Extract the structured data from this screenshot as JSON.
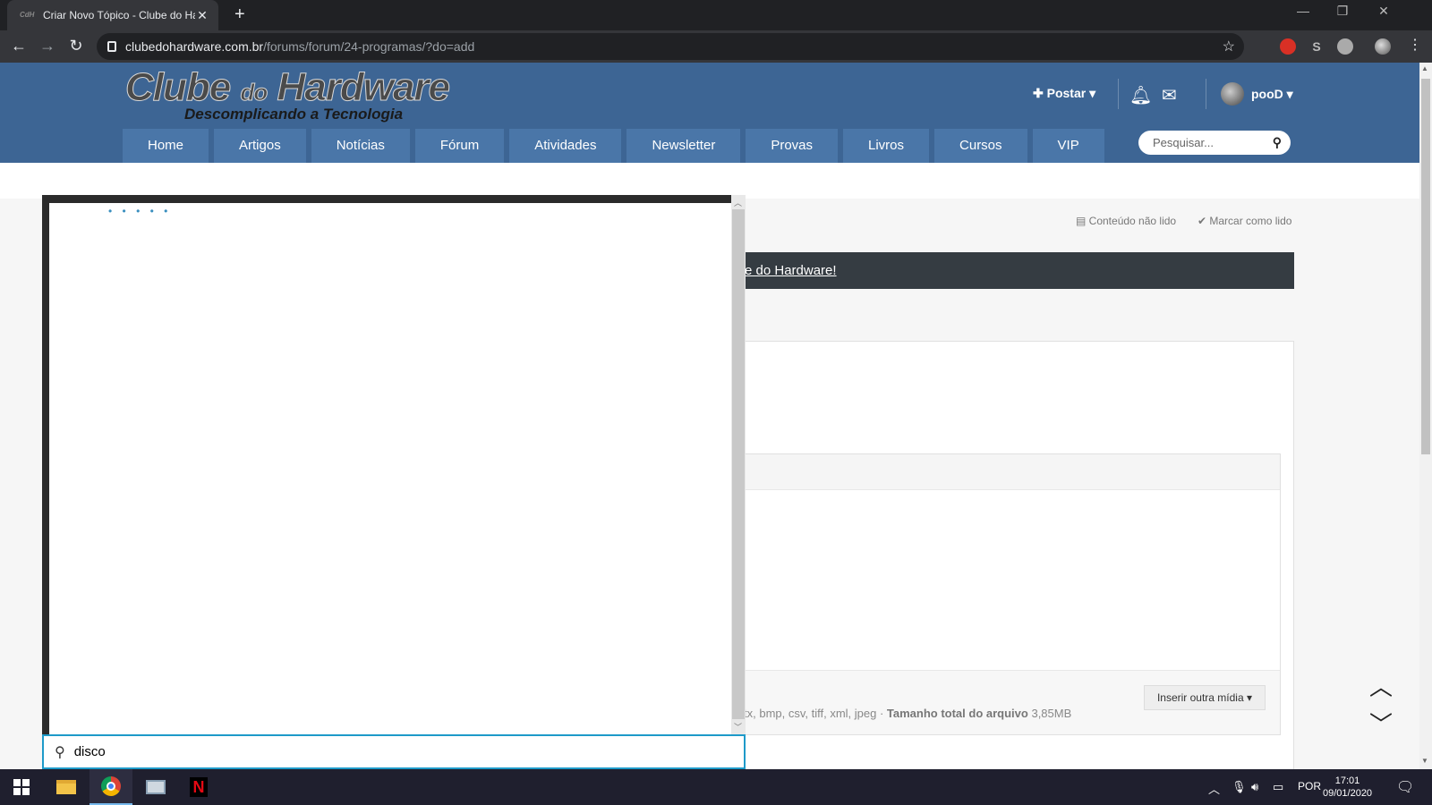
{
  "browser": {
    "tab_title": "Criar Novo Tópico - Clube do Hardware",
    "tab_favicon": "CdH",
    "url_domain": "clubedohardware.com.br",
    "url_path": "/forums/forum/24-programas/?do=add",
    "win_minimize": "—",
    "win_restore": "❐",
    "win_close": "✕"
  },
  "site": {
    "logo_main": "Clube",
    "logo_do": "do",
    "logo_hw": "Hardware",
    "logo_sub": "Descomplicando a Tecnologia",
    "postar_label": "Postar",
    "user_name": "pooD",
    "nav": [
      "Home",
      "Artigos",
      "Notícias",
      "Fórum",
      "Atividades",
      "Newsletter",
      "Provas",
      "Livros",
      "Cursos",
      "VIP"
    ],
    "search_placeholder": "Pesquisar...",
    "brand_color": "#3d6594",
    "nav_color": "#4a76a8"
  },
  "content": {
    "unread_label": "Conteúdo não lido",
    "mark_read_label": "Marcar como lido",
    "banner_text": "e do Hardware!",
    "file_types": "tx, bmp, csv, tiff, xml, jpeg · ",
    "total_size_label": "Tamanho total do arquivo",
    "total_size_value": "3,85MB",
    "insert_media_label": "Inserir outra mídia"
  },
  "flyout": {
    "loading_dots": "• • • • •",
    "search_value": "disco",
    "accent_color": "#1e9ac9"
  },
  "taskbar": {
    "language": "POR",
    "time": "17:01",
    "date": "09/01/2020"
  }
}
